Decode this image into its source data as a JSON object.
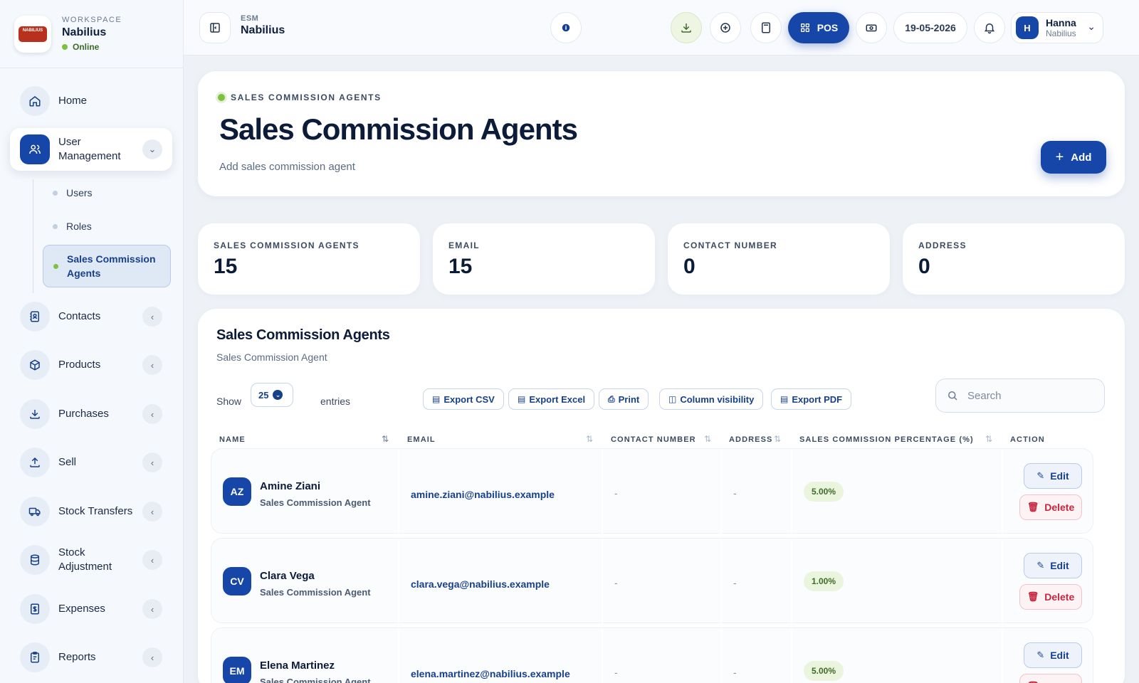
{
  "workspace": {
    "label": "WORKSPACE",
    "name": "Nabilius",
    "status": "Online",
    "logo_text": "NABILIUS"
  },
  "sidebar": {
    "items": [
      {
        "label": "Home",
        "icon": "home-icon"
      },
      {
        "label": "User Management",
        "icon": "users-icon"
      },
      {
        "label": "Contacts",
        "icon": "contacts-icon"
      },
      {
        "label": "Products",
        "icon": "box-icon"
      },
      {
        "label": "Purchases",
        "icon": "download-icon"
      },
      {
        "label": "Sell",
        "icon": "upload-icon"
      },
      {
        "label": "Stock Transfers",
        "icon": "truck-icon"
      },
      {
        "label": "Stock Adjustment",
        "icon": "database-icon"
      },
      {
        "label": "Expenses",
        "icon": "receipt-icon"
      },
      {
        "label": "Reports",
        "icon": "clipboard-icon"
      }
    ],
    "sub_items": [
      {
        "label": "Users"
      },
      {
        "label": "Roles"
      },
      {
        "label": "Sales Commission Agents"
      }
    ]
  },
  "topbar": {
    "esm_label": "ESM",
    "esm_name": "Nabilius",
    "pos_label": "POS",
    "date": "19-05-2026",
    "user_initial": "H",
    "user_name": "Hanna",
    "user_sub": "Nabilius"
  },
  "hero": {
    "tag": "SALES COMMISSION AGENTS",
    "title": "Sales Commission Agents",
    "subtitle": "Add sales commission agent",
    "add_label": "Add"
  },
  "stats": [
    {
      "label": "SALES COMMISSION AGENTS",
      "value": "15"
    },
    {
      "label": "EMAIL",
      "value": "15"
    },
    {
      "label": "CONTACT NUMBER",
      "value": "0"
    },
    {
      "label": "ADDRESS",
      "value": "0"
    }
  ],
  "table": {
    "title": "Sales Commission Agents",
    "subtitle": "Sales Commission Agent",
    "show_label": "Show",
    "entries_value": "25",
    "entries_label": "entries",
    "exports": [
      "Export CSV",
      "Export Excel",
      "Print",
      "Column visibility",
      "Export PDF"
    ],
    "search_placeholder": "Search",
    "columns": [
      "NAME",
      "EMAIL",
      "CONTACT NUMBER",
      "ADDRESS",
      "SALES COMMISSION PERCENTAGE (%)",
      "ACTION"
    ],
    "rows": [
      {
        "initials": "AZ",
        "name": "Amine Ziani",
        "role": "Sales Commission Agent",
        "email": "amine.ziani@nabilius.example",
        "contact": "-",
        "address": "-",
        "percent": "5.00%"
      },
      {
        "initials": "CV",
        "name": "Clara Vega",
        "role": "Sales Commission Agent",
        "email": "clara.vega@nabilius.example",
        "contact": "-",
        "address": "-",
        "percent": "1.00%"
      },
      {
        "initials": "EM",
        "name": "Elena Martinez",
        "role": "Sales Commission Agent",
        "email": "elena.martinez@nabilius.example",
        "contact": "-",
        "address": "-",
        "percent": "5.00%"
      }
    ],
    "edit_label": "Edit",
    "delete_label": "Delete"
  },
  "colors": {
    "primary": "#1546a8",
    "accent_green": "#7ec040",
    "danger": "#c5263f"
  }
}
